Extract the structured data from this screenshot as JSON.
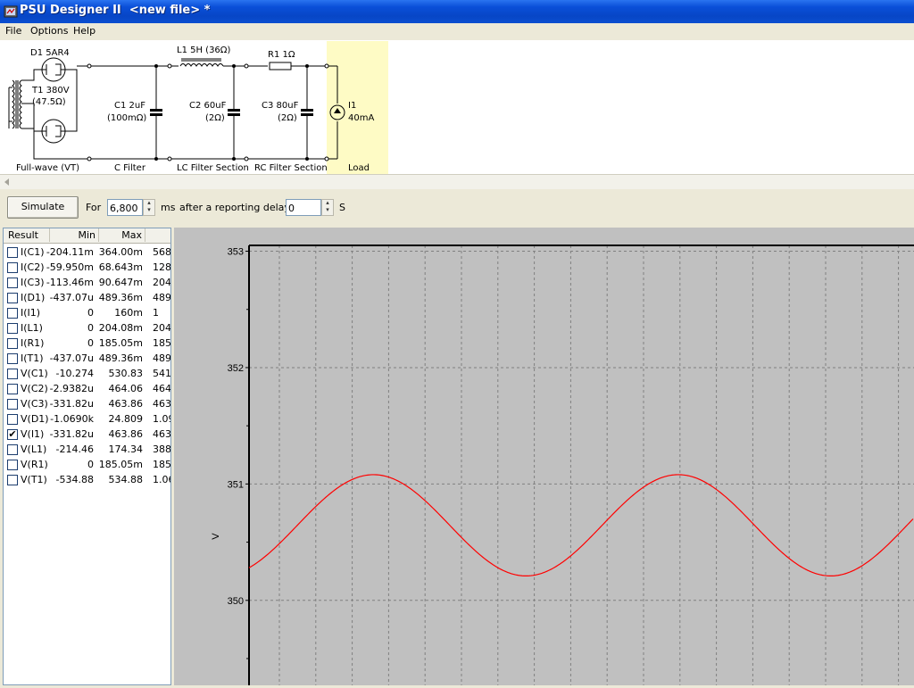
{
  "window": {
    "title": "PSU Designer II  <new file> *"
  },
  "menu": [
    "File",
    "Options",
    "Help"
  ],
  "schematic": {
    "d1": "D1 5AR4",
    "t1_a": "T1 380V",
    "t1_b": "(47.5Ω)",
    "l1": "L1 5H (36Ω)",
    "r1": "R1 1Ω",
    "c1_a": "C1 2uF",
    "c1_b": "(100mΩ)",
    "c2_a": "C2 60uF",
    "c2_b": "(2Ω)",
    "c3_a": "C3 80uF",
    "c3_b": "(2Ω)",
    "i1_a": "I1",
    "i1_b": "40mA",
    "sections": [
      "Full-wave (VT)",
      "C Filter",
      "LC Filter Section",
      "RC Filter Section",
      "Load"
    ]
  },
  "toolbar": {
    "simulate_label": "Simulate",
    "for_label": "For",
    "duration_value": "6,800",
    "ms_label": "ms",
    "delay_label": "after a reporting delay of",
    "delay_value": "0",
    "s_label": "S"
  },
  "results": {
    "headers": [
      "Result",
      "Min",
      "Max"
    ],
    "rows": [
      {
        "name": "I(C1)",
        "min": "-204.11m",
        "max": "364.00m",
        "avg": "568.",
        "checked": false
      },
      {
        "name": "I(C2)",
        "min": "-59.950m",
        "max": "68.643m",
        "avg": "128.",
        "checked": false
      },
      {
        "name": "I(C3)",
        "min": "-113.46m",
        "max": "90.647m",
        "avg": "204.",
        "checked": false
      },
      {
        "name": "I(D1)",
        "min": "-437.07u",
        "max": "489.36m",
        "avg": "489.",
        "checked": false
      },
      {
        "name": "I(I1)",
        "min": "0",
        "max": "160m",
        "avg": "1",
        "checked": false
      },
      {
        "name": "I(L1)",
        "min": "0",
        "max": "204.08m",
        "avg": "204.",
        "checked": false
      },
      {
        "name": "I(R1)",
        "min": "0",
        "max": "185.05m",
        "avg": "185.",
        "checked": false
      },
      {
        "name": "I(T1)",
        "min": "-437.07u",
        "max": "489.36m",
        "avg": "489.",
        "checked": false
      },
      {
        "name": "V(C1)",
        "min": "-10.274",
        "max": "530.83",
        "avg": "541",
        "checked": false
      },
      {
        "name": "V(C2)",
        "min": "-2.9382u",
        "max": "464.06",
        "avg": "464",
        "checked": false
      },
      {
        "name": "V(C3)",
        "min": "-331.82u",
        "max": "463.86",
        "avg": "463",
        "checked": false
      },
      {
        "name": "V(D1)",
        "min": "-1.0690k",
        "max": "24.809",
        "avg": "1.09",
        "checked": false
      },
      {
        "name": "V(I1)",
        "min": "-331.82u",
        "max": "463.86",
        "avg": "463",
        "checked": true
      },
      {
        "name": "V(L1)",
        "min": "-214.46",
        "max": "174.34",
        "avg": "388",
        "checked": false
      },
      {
        "name": "V(R1)",
        "min": "0",
        "max": "185.05m",
        "avg": "185.",
        "checked": false
      },
      {
        "name": "V(T1)",
        "min": "-534.88",
        "max": "534.88",
        "avg": "1.06",
        "checked": false
      }
    ]
  },
  "chart_data": {
    "type": "line",
    "ylabel": "V",
    "yticks": [
      353,
      352,
      351,
      350
    ],
    "ylim": [
      349.27,
      353.05
    ],
    "grid": true,
    "series_color": "#ff0000",
    "series": [
      {
        "amplitude_V": 0.435,
        "center_V": 350.645,
        "period_grid_cols": 4.5,
        "start_V": 350.28
      }
    ]
  }
}
